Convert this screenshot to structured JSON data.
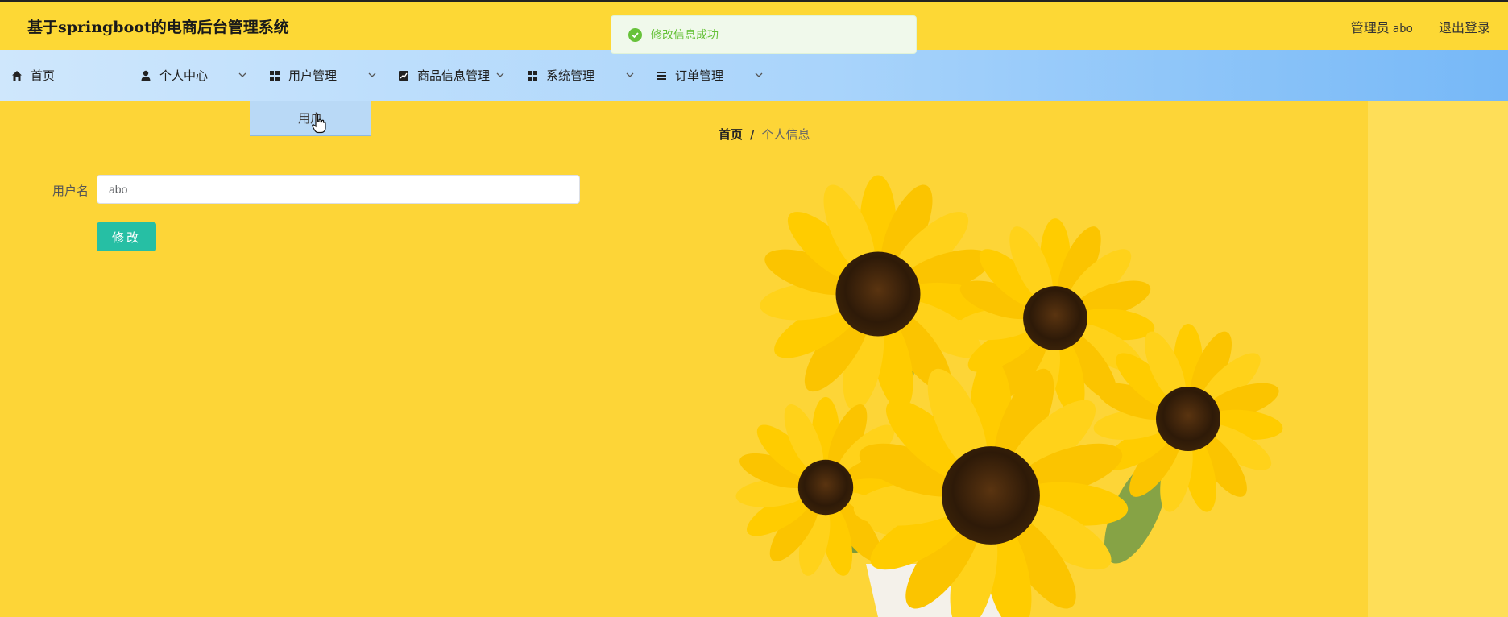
{
  "header": {
    "app_title": "基于springboot的电商后台管理系统",
    "role_label": "管理员",
    "username": "abo",
    "logout_label": "退出登录"
  },
  "toast": {
    "message": "修改信息成功",
    "type": "success",
    "color": "#67c23a"
  },
  "nav": {
    "items": [
      {
        "label": "首页",
        "icon": "home-icon",
        "has_children": false
      },
      {
        "label": "个人中心",
        "icon": "user-icon",
        "has_children": true
      },
      {
        "label": "用户管理",
        "icon": "grid-icon",
        "has_children": true
      },
      {
        "label": "商品信息管理",
        "icon": "chart-icon",
        "has_children": true
      },
      {
        "label": "系统管理",
        "icon": "grid-icon",
        "has_children": true
      },
      {
        "label": "订单管理",
        "icon": "list-icon",
        "has_children": true
      }
    ],
    "submenu": {
      "parent": "用户管理",
      "items": [
        {
          "label": "用户"
        }
      ]
    }
  },
  "breadcrumb": {
    "home": "首页",
    "separator": "/",
    "current": "个人信息"
  },
  "form": {
    "username_label": "用户名",
    "username_value": "abo",
    "submit_label": "修改"
  },
  "colors": {
    "header_bg": "#fdd835",
    "nav_gradient_start": "#cfe7fc",
    "nav_gradient_end": "#76b8f7",
    "page_bg": "#fdd537",
    "submit_button": "#26bfa4",
    "success": "#67c23a"
  }
}
